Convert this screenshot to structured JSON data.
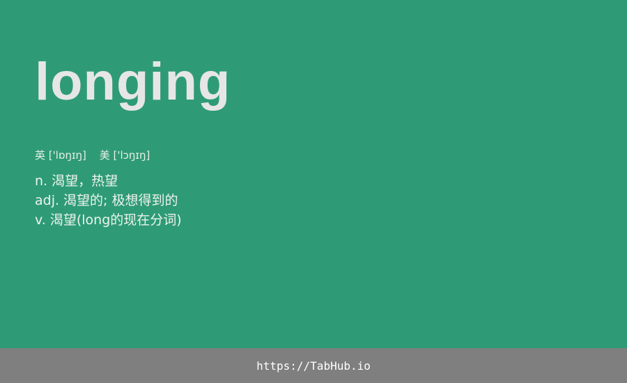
{
  "card": {
    "word": "longing",
    "phonetics": {
      "uk_label": "英",
      "uk_ipa": "['lɒŋɪŋ]",
      "us_label": "美",
      "us_ipa": "['lɔŋɪŋ]"
    },
    "definitions": [
      "n. 渴望，热望",
      "adj. 渴望的; 极想得到的",
      "v. 渴望(long的现在分词)"
    ]
  },
  "footer": {
    "link": "https://TabHub.io"
  },
  "colors": {
    "background": "#2e9b76",
    "footer": "#7f7f7f",
    "word": "#e6e6e6"
  }
}
